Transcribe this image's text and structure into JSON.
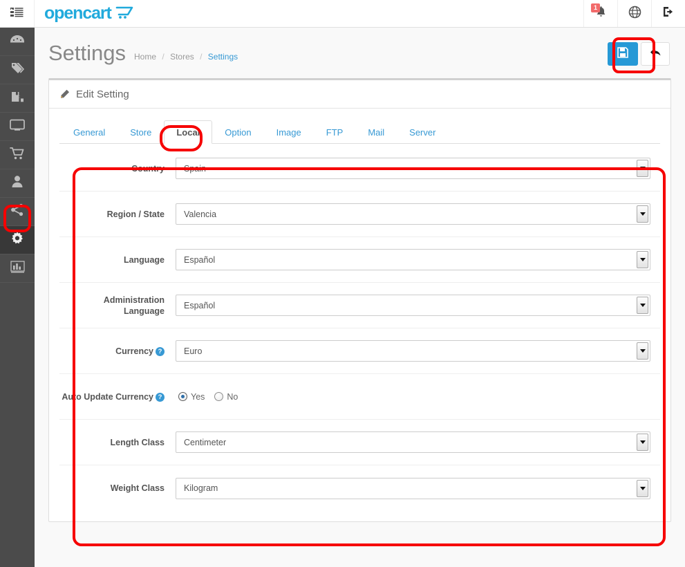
{
  "header": {
    "menu_toggle_label": "",
    "logo_text": "opencart",
    "notification_count": "1",
    "buttons": [
      {
        "name": "notifications",
        "icon": "bell-icon"
      },
      {
        "name": "store-front",
        "icon": "globe-icon"
      },
      {
        "name": "logout",
        "icon": "logout-icon"
      }
    ]
  },
  "sidebar": {
    "items": [
      {
        "label": "Dashboard",
        "icon": "dashboard-icon",
        "active": false
      },
      {
        "label": "Catalog",
        "icon": "tag-icon",
        "active": false
      },
      {
        "label": "Extensions",
        "icon": "puzzle-icon",
        "active": false
      },
      {
        "label": "Design",
        "icon": "monitor-icon",
        "active": false
      },
      {
        "label": "Sales",
        "icon": "cart-icon",
        "active": false
      },
      {
        "label": "Customers",
        "icon": "user-icon",
        "active": false
      },
      {
        "label": "Marketing",
        "icon": "share-icon",
        "active": false
      },
      {
        "label": "System",
        "icon": "gear-icon",
        "active": true
      },
      {
        "label": "Reports",
        "icon": "chart-icon",
        "active": false
      }
    ]
  },
  "page": {
    "title": "Settings",
    "breadcrumb": {
      "home": "Home",
      "stores": "Stores",
      "current": "Settings",
      "separator": "/"
    },
    "actions": {
      "save_label": "Save",
      "back_label": "Back"
    }
  },
  "card": {
    "heading": "Edit Setting"
  },
  "tabs": [
    {
      "label": "General",
      "active": false
    },
    {
      "label": "Store",
      "active": false
    },
    {
      "label": "Local",
      "active": true
    },
    {
      "label": "Option",
      "active": false
    },
    {
      "label": "Image",
      "active": false
    },
    {
      "label": "FTP",
      "active": false
    },
    {
      "label": "Mail",
      "active": false
    },
    {
      "label": "Server",
      "active": false
    }
  ],
  "form": {
    "rows": [
      {
        "label": "Country",
        "type": "select",
        "value": "Spain",
        "help": false
      },
      {
        "label": "Region / State",
        "type": "select",
        "value": "Valencia",
        "help": false
      },
      {
        "label": "Language",
        "type": "select",
        "value": "Español",
        "help": false
      },
      {
        "label": "Administration Language",
        "type": "select",
        "value": "Español",
        "help": false
      },
      {
        "label": "Currency",
        "type": "select",
        "value": "Euro",
        "help": true
      },
      {
        "label": "Auto Update Currency",
        "type": "radio",
        "help": true,
        "options": [
          {
            "label": "Yes",
            "checked": true
          },
          {
            "label": "No",
            "checked": false
          }
        ]
      },
      {
        "label": "Length Class",
        "type": "select",
        "value": "Centimeter",
        "help": false
      },
      {
        "label": "Weight Class",
        "type": "select",
        "value": "Kilogram",
        "help": false
      }
    ],
    "help_glyph": "?"
  },
  "colors": {
    "brand_blue": "#21aadc",
    "link_blue": "#3799d4",
    "save_button": "#2699d6",
    "sidebar": "#4b4b4b",
    "sidebar_active": "#383838",
    "badge_red": "#f26b6b",
    "annotation_red": "#f60000"
  }
}
